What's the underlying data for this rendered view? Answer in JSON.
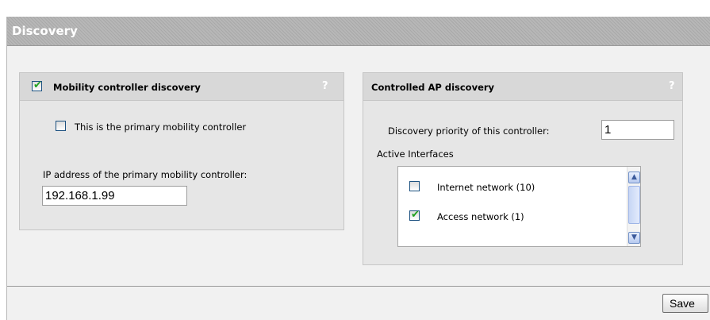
{
  "page": {
    "title": "Discovery"
  },
  "mobility_panel": {
    "heading": "Mobility controller discovery",
    "help": "?",
    "enabled": true,
    "primary_checkbox_label": "This is the primary mobility controller",
    "primary_checked": false,
    "ip_label": "IP address of the primary mobility controller:",
    "ip_value": "192.168.1.99"
  },
  "ap_panel": {
    "heading": "Controlled AP discovery",
    "help": "?",
    "priority_label": "Discovery priority of this controller:",
    "priority_value": "1",
    "interfaces_label": "Active Interfaces",
    "interfaces": [
      {
        "label": "Internet network (10)",
        "checked": false
      },
      {
        "label": "Access network (1)",
        "checked": true
      }
    ]
  },
  "footer": {
    "save_label": "Save"
  },
  "colors": {
    "accent_check": "#21a121",
    "title_text": "#ffffff"
  },
  "icons": {
    "checkmark": "check-icon",
    "scroll_up": "chevron-up-icon",
    "scroll_down": "chevron-down-icon",
    "help": "help-icon"
  }
}
